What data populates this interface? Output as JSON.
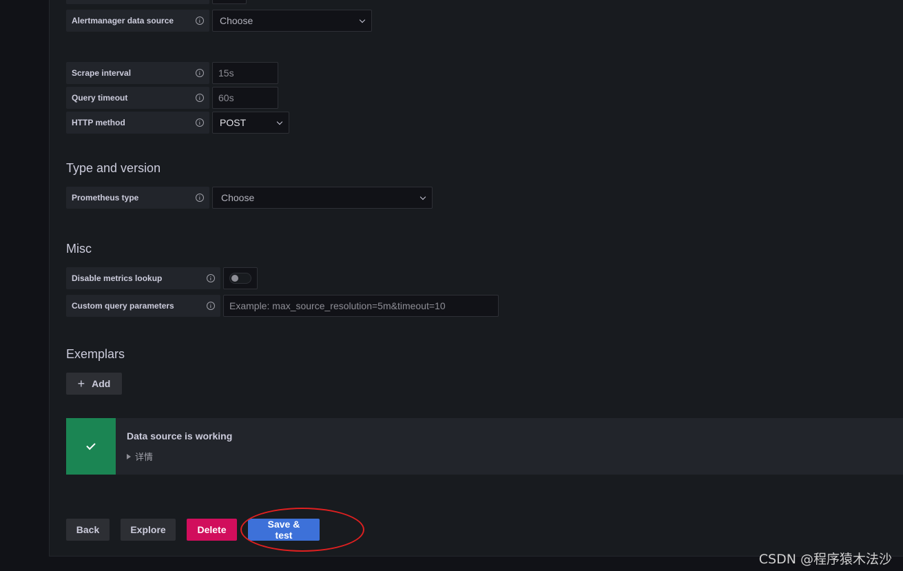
{
  "form": {
    "alertmanager": {
      "label": "Alertmanager data source",
      "value": "Choose"
    },
    "scrape_interval": {
      "label": "Scrape interval",
      "placeholder": "15s"
    },
    "query_timeout": {
      "label": "Query timeout",
      "placeholder": "60s"
    },
    "http_method": {
      "label": "HTTP method",
      "value": "POST"
    }
  },
  "type_version": {
    "title": "Type and version",
    "prometheus_type": {
      "label": "Prometheus type",
      "value": "Choose"
    }
  },
  "misc": {
    "title": "Misc",
    "disable_metrics_lookup": {
      "label": "Disable metrics lookup",
      "enabled": false
    },
    "custom_query_parameters": {
      "label": "Custom query parameters",
      "placeholder": "Example: max_source_resolution=5m&timeout=10"
    }
  },
  "exemplars": {
    "title": "Exemplars",
    "add_label": "Add"
  },
  "alert": {
    "status": "success",
    "title": "Data source is working",
    "details_label": "详情",
    "color": "#1b8553"
  },
  "actions": {
    "back": "Back",
    "explore": "Explore",
    "delete": "Delete",
    "save_test": "Save & test"
  },
  "watermark": "CSDN @程序猿木法沙"
}
